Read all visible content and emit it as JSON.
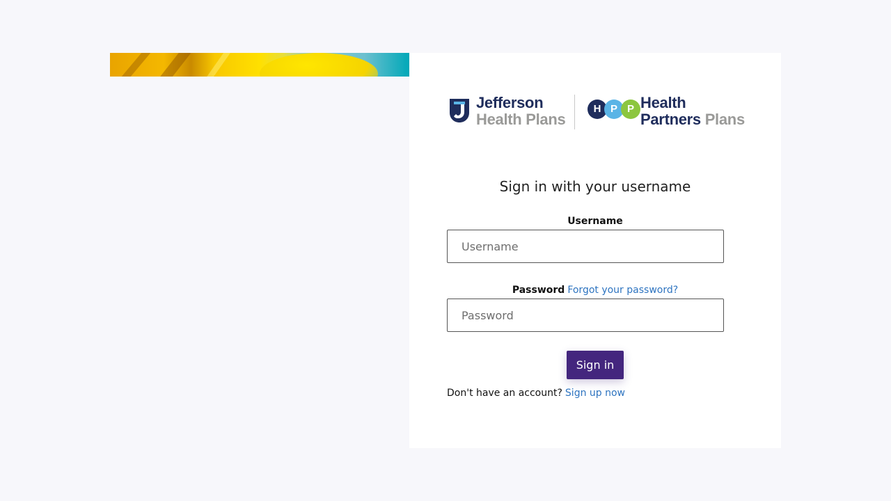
{
  "logos": {
    "jefferson_line1": "Jefferson",
    "jefferson_line2": "Health Plans",
    "hpp_circles": [
      "H",
      "P",
      "P"
    ],
    "hpp_line1": "Health",
    "hpp_line2_a": "Partners",
    "hpp_line2_b": "Plans"
  },
  "form": {
    "heading": "Sign in with your username",
    "username_label": "Username",
    "username_placeholder": "Username",
    "username_value": "",
    "password_label": "Password",
    "forgot_password_link": "Forgot your password?",
    "password_placeholder": "Password",
    "password_value": "",
    "signin_button": "Sign in",
    "no_account_text": "Don't have an account?",
    "signup_link": "Sign up now"
  },
  "colors": {
    "page_background": "#f7f7fb",
    "panel_background": "#ffffff",
    "primary_button": "#44267e",
    "link": "#2e74c0",
    "brand_navy": "#1f2d5c",
    "brand_gray": "#9a9a98",
    "hpp_blue": "#5ab4e6",
    "hpp_green": "#8cc63f"
  },
  "icons": {
    "banner": "sunflower-banner-image",
    "jefferson_logo": "jefferson-shield-icon"
  }
}
